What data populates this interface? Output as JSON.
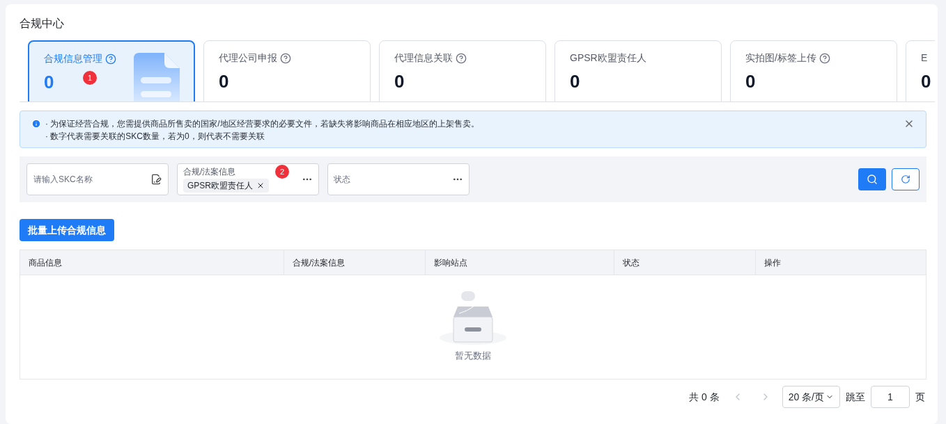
{
  "page": {
    "title": "合规中心"
  },
  "cards": [
    {
      "label": "合规信息管理",
      "count": "0",
      "help": true,
      "selected": true,
      "badge": "1",
      "illustration": true
    },
    {
      "label": "代理公司申报",
      "count": "0",
      "help": true,
      "selected": false
    },
    {
      "label": "代理信息关联",
      "count": "0",
      "help": true,
      "selected": false
    },
    {
      "label": "GPSR欧盟责任人",
      "count": "0",
      "help": false,
      "selected": false
    },
    {
      "label": "实拍图/标签上传",
      "count": "0",
      "help": true,
      "selected": false
    },
    {
      "label": "E",
      "count": "0",
      "help": false,
      "selected": false
    }
  ],
  "notice": {
    "lines": [
      "· 为保证经营合规，您需提供商品所售卖的国家/地区经营要求的必要文件，若缺失将影响商品在相应地区的上架售卖。",
      "· 数字代表需要关联的SKC数量，若为0，则代表不需要关联"
    ]
  },
  "filters": [
    {
      "kind": "input",
      "placeholder": "请输入SKC名称"
    },
    {
      "kind": "select",
      "label": "合规/法案信息",
      "badge": "2",
      "tags": [
        "GPSR欧盟责任人"
      ]
    },
    {
      "kind": "select",
      "placeholder": "状态"
    }
  ],
  "batch_button": "批量上传合规信息",
  "table": {
    "columns": [
      "商品信息",
      "合规/法案信息",
      "影响站点",
      "状态",
      "操作"
    ],
    "empty_text": "暂无数据"
  },
  "pagination": {
    "total": "共 0 条",
    "prev_disabled": true,
    "next_disabled": true,
    "page_size": "20 条/页",
    "jump_label": "跳至",
    "page": "1",
    "page_suffix": "页"
  }
}
